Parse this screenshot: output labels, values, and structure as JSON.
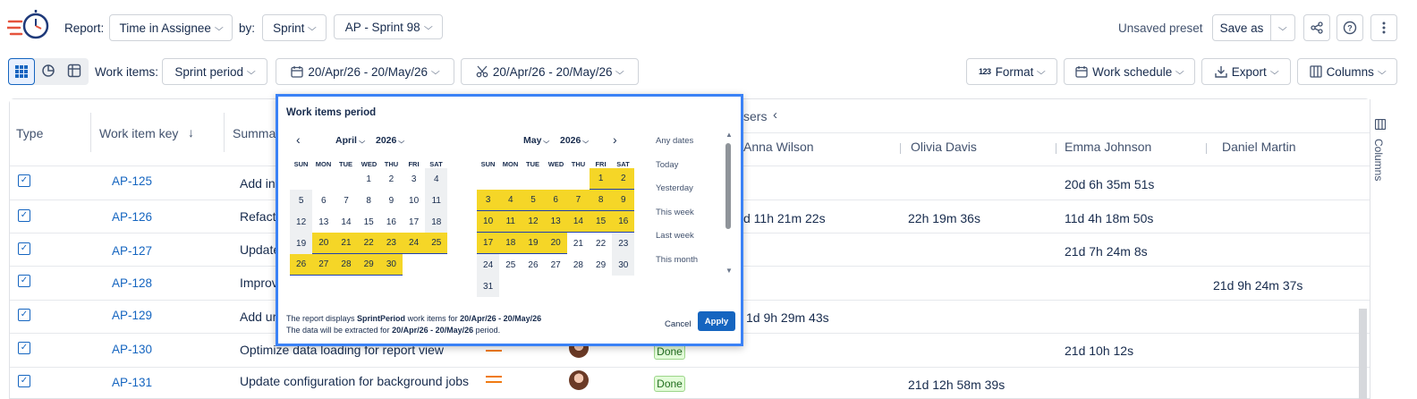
{
  "toolbar": {
    "report_label": "Report:",
    "report_value": "Time in Assignee",
    "by_label": "by:",
    "by_value": "Sprint",
    "sprint_value": "AP - Sprint 98",
    "unsaved_preset": "Unsaved preset",
    "save_as": "Save as"
  },
  "filterbar": {
    "work_items_label": "Work items:",
    "work_items_value": "Sprint period",
    "date_range_1": "20/Apr/26 - 20/May/26",
    "date_range_2": "20/Apr/26 - 20/May/26",
    "format": "Format",
    "format_prefix": "123",
    "work_schedule": "Work schedule",
    "export": "Export",
    "columns": "Columns"
  },
  "table": {
    "headers": {
      "type": "Type",
      "key": "Work item key",
      "summary": "Summar",
      "users_group": "sers",
      "users": [
        "Anna Wilson",
        "Olivia Davis",
        "Emma Johnson",
        "Daniel Martin"
      ]
    },
    "rows": [
      {
        "key": "AP-125",
        "summary": "Add in",
        "anna": "",
        "olivia": "",
        "emma": "20d 6h 35m 51s",
        "daniel": ""
      },
      {
        "key": "AP-126",
        "summary": "Refact",
        "anna": "d 11h 21m 22s",
        "olivia": "22h 19m 36s",
        "emma": "11d 4h 18m 50s",
        "daniel": ""
      },
      {
        "key": "AP-127",
        "summary": "Update",
        "anna": "",
        "olivia": "",
        "emma": "21d 7h 24m 8s",
        "daniel": ""
      },
      {
        "key": "AP-128",
        "summary": "Improv",
        "anna": "",
        "olivia": "",
        "emma": "",
        "daniel": "21d 9h 24m 37s"
      },
      {
        "key": "AP-129",
        "summary": "Add ur",
        "anna": "1d 9h 29m 43s",
        "olivia": "",
        "emma": "",
        "daniel": ""
      },
      {
        "key": "AP-130",
        "summary": "Optimize data loading for report view",
        "status": "Done",
        "anna": "",
        "olivia": "",
        "emma": "21d 10h 12s",
        "daniel": ""
      },
      {
        "key": "AP-131",
        "summary": "Update configuration for background jobs",
        "status": "Done",
        "anna": "",
        "olivia": "21d 12h 58m 39s",
        "emma": "",
        "daniel": ""
      }
    ],
    "side_columns_label": "Columns"
  },
  "popup": {
    "title": "Work items period",
    "left_month": "April",
    "left_year": "2026",
    "right_month": "May",
    "right_year": "2026",
    "dow": [
      "SUN",
      "MON",
      "TUE",
      "WED",
      "THU",
      "FRI",
      "SAT"
    ],
    "quick_options": [
      "Any dates",
      "Today",
      "Yesterday",
      "This week",
      "Last week",
      "This month"
    ],
    "footer_line1_pre": "The report displays ",
    "footer_line1_bold1": "SprintPeriod",
    "footer_line1_mid": " work items for ",
    "footer_line1_bold2": "20/Apr/26 - 20/May/26",
    "footer_line2_pre": "The data will be extracted for ",
    "footer_line2_bold": "20/Apr/26 - 20/May/26",
    "footer_line2_post": " period.",
    "cancel": "Cancel",
    "apply": "Apply"
  },
  "colors": {
    "accent": "#1565c0",
    "selected_range": "#f5d627",
    "popup_border": "#3b82f6",
    "priority_medium": "#f07a12",
    "done_badge": "#e3fcd9"
  }
}
